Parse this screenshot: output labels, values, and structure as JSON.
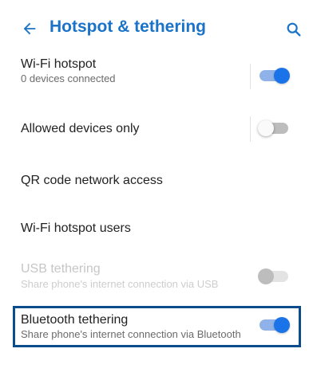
{
  "header": {
    "title": "Hotspot & tethering",
    "back_icon": "arrow-back-icon",
    "search_icon": "search-icon",
    "accent_color": "#1a73c9"
  },
  "settings": [
    {
      "title": "Wi-Fi hotspot",
      "subtitle": "0 devices connected",
      "toggle": "on",
      "enabled": true
    },
    {
      "title": "Allowed devices only",
      "toggle": "off",
      "enabled": true
    },
    {
      "title": "QR code network access",
      "enabled": true
    },
    {
      "title": "Wi-Fi hotspot users",
      "enabled": true
    },
    {
      "title": "USB tethering",
      "subtitle": "Share phone's internet connection via USB",
      "toggle": "off",
      "enabled": false
    },
    {
      "title": "Bluetooth tethering",
      "subtitle": "Share phone's internet connection via Bluetooth",
      "toggle": "on",
      "enabled": true,
      "highlighted": true
    }
  ],
  "colors": {
    "toggle_on_thumb": "#1a73e8",
    "toggle_on_track": "#8fb3e8",
    "highlight_border": "#0b4d8c"
  }
}
